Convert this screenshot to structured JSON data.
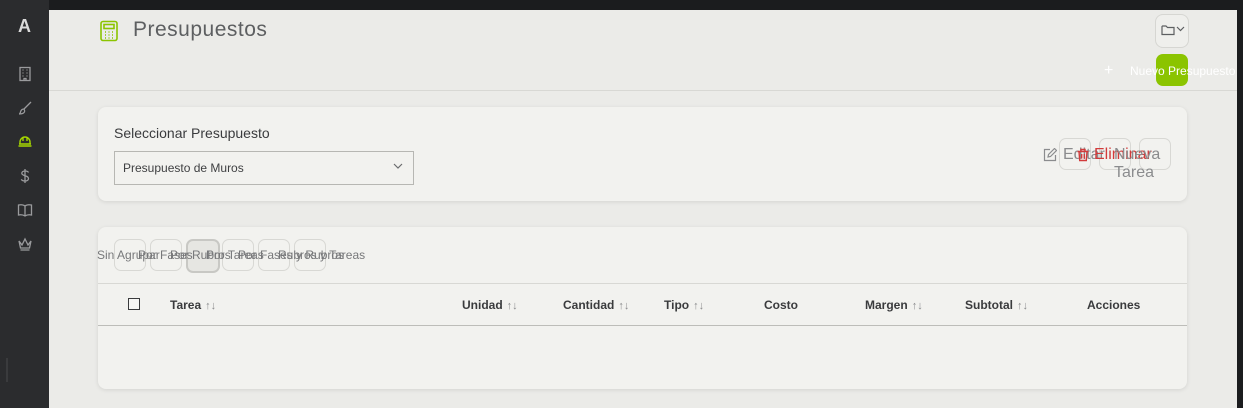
{
  "sidebar": {
    "logo": "A",
    "items": [
      {
        "icon": "building-icon"
      },
      {
        "icon": "brush-icon"
      },
      {
        "icon": "hard-hat-icon",
        "active": true
      },
      {
        "icon": "dollar-icon"
      },
      {
        "icon": "book-icon"
      },
      {
        "icon": "crown-icon"
      }
    ],
    "active_color": "#a6d600"
  },
  "header": {
    "title": "Presupuestos",
    "title_icon": "calculator-icon",
    "new_button_label": "Nuevo Presupuesto",
    "new_button_plus": "+",
    "accent": "#8bc400"
  },
  "selector": {
    "label": "Seleccionar Presupuesto",
    "value": "Presupuesto de Muros",
    "actions": {
      "edit": "Editar",
      "delete": "Eliminar",
      "new_task": "Nueva Tarea"
    }
  },
  "grouping": {
    "options": [
      "Sin Agrupar",
      "Por Fases",
      "Por Rubros",
      "Por Tareas",
      "Por Fases y Rubros",
      "Rubros y Tareas"
    ],
    "active_index": 2
  },
  "table": {
    "columns": [
      "Tarea",
      "Unidad",
      "Cantidad",
      "Tipo",
      "Costo",
      "Margen",
      "Subtotal",
      "Acciones"
    ],
    "sort_glyph": "↑↓",
    "rows": []
  }
}
